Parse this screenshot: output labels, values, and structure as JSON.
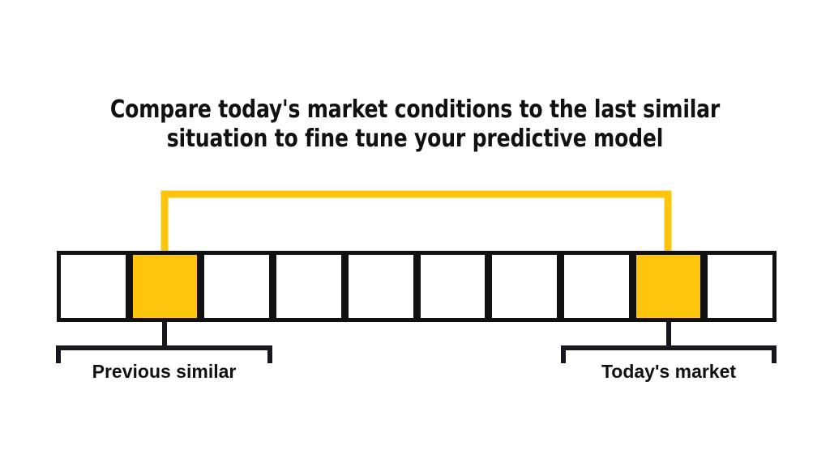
{
  "title": {
    "line1": "Compare today's market conditions to the last similar",
    "line2": "situation to fine tune your predictive model"
  },
  "colors": {
    "highlight": "#FFC40C",
    "outline": "#111111",
    "bracket": "#16181D",
    "background": "#FFFFFF"
  },
  "timeline": {
    "cell_count": 10,
    "cells": [
      {
        "index": 0,
        "state": "normal"
      },
      {
        "index": 1,
        "state": "highlighted"
      },
      {
        "index": 2,
        "state": "normal"
      },
      {
        "index": 3,
        "state": "normal"
      },
      {
        "index": 4,
        "state": "normal"
      },
      {
        "index": 5,
        "state": "normal"
      },
      {
        "index": 6,
        "state": "normal"
      },
      {
        "index": 7,
        "state": "normal"
      },
      {
        "index": 8,
        "state": "highlighted"
      },
      {
        "index": 9,
        "state": "normal"
      }
    ]
  },
  "connector": {
    "name": "yellow-link",
    "from_cell_index": 1,
    "to_cell_index": 8,
    "color": "#FFC40C"
  },
  "groups": {
    "left": {
      "label": "Previous similar",
      "cell_index": 1
    },
    "right": {
      "label": "Today's market",
      "cell_index": 8
    }
  }
}
